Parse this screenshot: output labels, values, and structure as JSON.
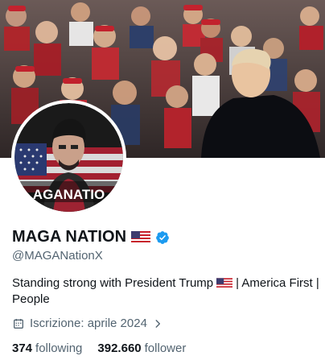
{
  "profile": {
    "name": "MAGA NATION",
    "handle": "@MAGANationX",
    "bio_line1": "Standing strong with President Trump",
    "bio_line1_suffix": "| America First |",
    "bio_line2": "People",
    "joined": "Iscrizione: aprile 2024",
    "avatar_text": "AGANATIO"
  },
  "stats": {
    "following_count": "374",
    "following_label": "following",
    "followers_count": "392.660",
    "followers_label": "follower"
  },
  "colors": {
    "verified": "#1d9bf0",
    "secondary_text": "#536471",
    "primary_text": "#0f1419"
  },
  "icons": {
    "verified": "verified-badge-icon",
    "calendar": "calendar-icon",
    "chevron": "chevron-right-icon"
  }
}
